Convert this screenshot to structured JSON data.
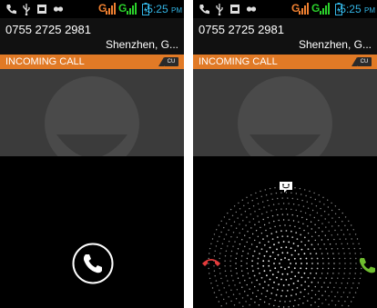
{
  "status_bar": {
    "time": "5:25",
    "ampm": "PM",
    "carrier_1": "G",
    "carrier_2": "G",
    "icons": [
      "phone-icon",
      "usb-icon",
      "screenshot-icon",
      "voicemail-icon",
      "signal-icon",
      "battery-icon"
    ]
  },
  "caller": {
    "number": "0755 2725 2981",
    "location": "Shenzhen, G..."
  },
  "banner": {
    "state": "INCOMING CALL",
    "sim_badge": "CU"
  },
  "controls": {
    "answer_icon": "phone-handset-icon",
    "decline_icon": "decline-call-icon",
    "message_icon": "message-icon",
    "accept_icon": "accept-call-icon"
  },
  "colors": {
    "accent_orange": "#e17a26",
    "status_blue": "#33b5e5",
    "signal_green": "#2bd12b",
    "decline_red": "#e23b3b",
    "accept_green": "#6fbd2f"
  }
}
